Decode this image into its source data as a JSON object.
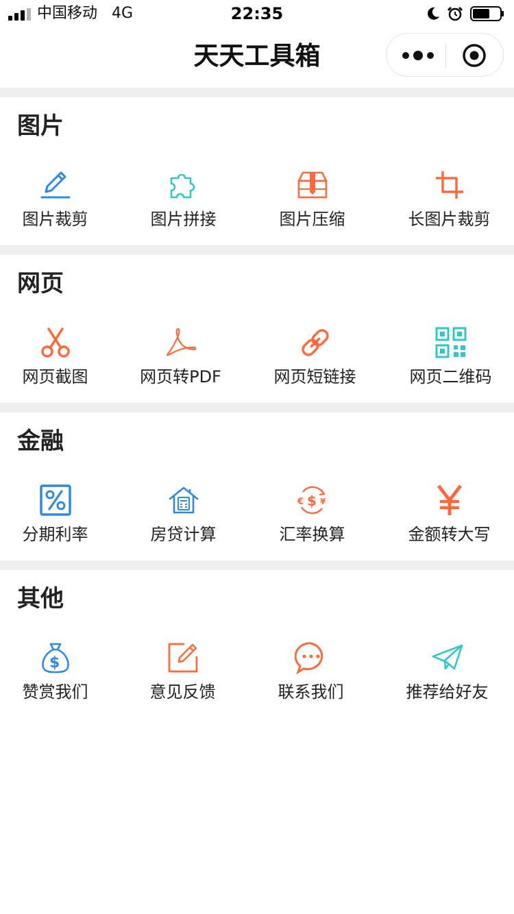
{
  "status_bar": {
    "carrier": "中国移动",
    "network": "4G",
    "time": "22:35"
  },
  "nav": {
    "title": "天天工具箱"
  },
  "sections": [
    {
      "title": "图片",
      "items": [
        {
          "label": "图片裁剪",
          "icon": "pencil-icon",
          "color": "#2d8ae0"
        },
        {
          "label": "图片拼接",
          "icon": "puzzle-icon",
          "color": "#32c6c6"
        },
        {
          "label": "图片压缩",
          "icon": "archive-box-icon",
          "color": "#ff6a3d"
        },
        {
          "label": "长图片裁剪",
          "icon": "crop-icon",
          "color": "#ff6a3d"
        }
      ]
    },
    {
      "title": "网页",
      "items": [
        {
          "label": "网页截图",
          "icon": "scissors-icon",
          "color": "#ff6a3d"
        },
        {
          "label": "网页转PDF",
          "icon": "pdf-icon",
          "color": "#ff6a3d"
        },
        {
          "label": "网页短链接",
          "icon": "link-icon",
          "color": "#ff6a3d"
        },
        {
          "label": "网页二维码",
          "icon": "qrcode-icon",
          "color": "#32c6c6"
        }
      ]
    },
    {
      "title": "金融",
      "items": [
        {
          "label": "分期利率",
          "icon": "percent-icon",
          "color": "#2d8ae0"
        },
        {
          "label": "房贷计算",
          "icon": "house-calculator-icon",
          "color": "#2d8ae0"
        },
        {
          "label": "汇率换算",
          "icon": "currency-exchange-icon",
          "color": "#ff6a3d"
        },
        {
          "label": "金额转大写",
          "icon": "yen-icon",
          "color": "#ff6a3d"
        }
      ]
    },
    {
      "title": "其他",
      "items": [
        {
          "label": "赞赏我们",
          "icon": "money-bag-icon",
          "color": "#2d8ae0"
        },
        {
          "label": "意见反馈",
          "icon": "edit-note-icon",
          "color": "#ff6a3d"
        },
        {
          "label": "联系我们",
          "icon": "chat-bubble-icon",
          "color": "#ff6a3d"
        },
        {
          "label": "推荐给好友",
          "icon": "paper-plane-icon",
          "color": "#32c6c6"
        }
      ]
    }
  ]
}
